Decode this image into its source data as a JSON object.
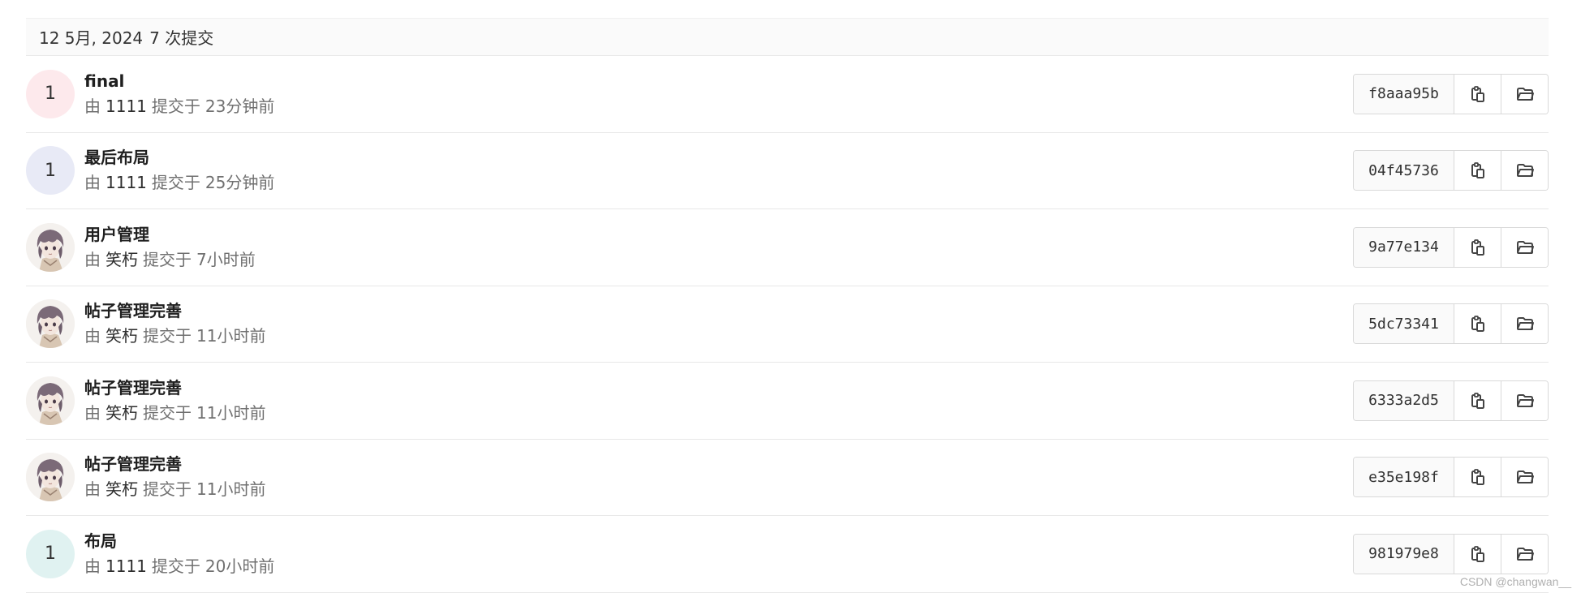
{
  "header": {
    "date": "12 5月, 2024",
    "count": "7 次提交"
  },
  "commits": [
    {
      "title": "final",
      "by": "由",
      "author": "1111",
      "submitted": "提交于",
      "time": "23分钟前",
      "sha": "f8aaa95b",
      "avatar": {
        "type": "initial",
        "text": "1",
        "color": "#fde9ec"
      }
    },
    {
      "title": "最后布局",
      "by": "由",
      "author": "1111",
      "submitted": "提交于",
      "time": "25分钟前",
      "sha": "04f45736",
      "avatar": {
        "type": "initial",
        "text": "1",
        "color": "#e8eaf6"
      }
    },
    {
      "title": "用户管理",
      "by": "由",
      "author": "笑朽",
      "submitted": "提交于",
      "time": "7小时前",
      "sha": "9a77e134",
      "avatar": {
        "type": "image",
        "icon": "anime-character-avatar"
      }
    },
    {
      "title": "帖子管理完善",
      "by": "由",
      "author": "笑朽",
      "submitted": "提交于",
      "time": "11小时前",
      "sha": "5dc73341",
      "avatar": {
        "type": "image",
        "icon": "anime-character-avatar"
      }
    },
    {
      "title": "帖子管理完善",
      "by": "由",
      "author": "笑朽",
      "submitted": "提交于",
      "time": "11小时前",
      "sha": "6333a2d5",
      "avatar": {
        "type": "image",
        "icon": "anime-character-avatar"
      }
    },
    {
      "title": "帖子管理完善",
      "by": "由",
      "author": "笑朽",
      "submitted": "提交于",
      "time": "11小时前",
      "sha": "e35e198f",
      "avatar": {
        "type": "image",
        "icon": "anime-character-avatar"
      }
    },
    {
      "title": "布局",
      "by": "由",
      "author": "1111",
      "submitted": "提交于",
      "time": "20小时前",
      "sha": "981979e8",
      "avatar": {
        "type": "initial",
        "text": "1",
        "color": "#e0f2f1"
      }
    }
  ],
  "icons": {
    "copy": "copy-sha-icon",
    "browse": "browse-files-icon"
  },
  "watermark": "CSDN @changwan__"
}
